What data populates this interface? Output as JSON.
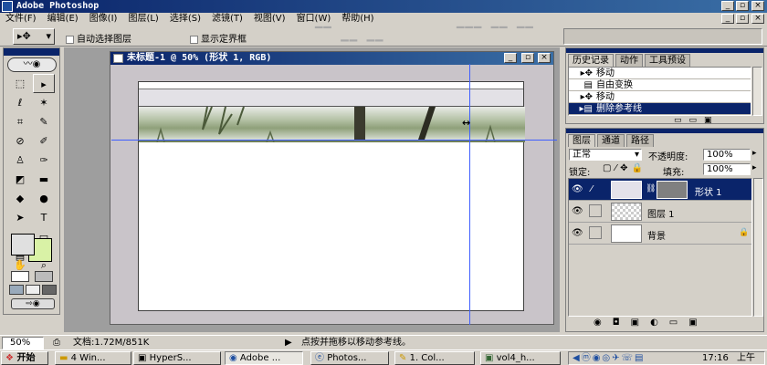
{
  "app": {
    "title": "Adobe Photoshop"
  },
  "menu": [
    "文件(F)",
    "编辑(E)",
    "图像(I)",
    "图层(L)",
    "选择(S)",
    "滤镜(T)",
    "视图(V)",
    "窗口(W)",
    "帮助(H)"
  ],
  "options": {
    "auto_select": "自动选择图层",
    "show_bounds": "显示定界框",
    "ghost_align": "▔▔ ▁▁ ▁▁",
    "ghost_distribute": "▔▔▔ ▔▔ ▔▔"
  },
  "document": {
    "title": "未标题-1 @ 50% (形状 1, RGB)"
  },
  "history": {
    "tabs": [
      "历史记录",
      "动作",
      "工具预设"
    ],
    "items": [
      "移动",
      "自由变换",
      "移动",
      "删除参考线"
    ],
    "selected_index": 3
  },
  "layers": {
    "tabs": [
      "图层",
      "通道",
      "路径"
    ],
    "blend_mode": "正常",
    "opacity_label": "不透明度:",
    "opacity": "100%",
    "lock_label": "锁定:",
    "fill_label": "填充:",
    "fill": "100%",
    "items": [
      {
        "name": "形状 1",
        "selected": true
      },
      {
        "name": "图层 1",
        "selected": false
      },
      {
        "name": "背景",
        "selected": false
      }
    ]
  },
  "status": {
    "zoom": "50%",
    "doc_info": "文档:1.72M/851K",
    "hint": "点按并拖移以移动参考线。"
  },
  "taskbar": {
    "start": "开始",
    "tasks": [
      "4 Win...",
      "HyperS...",
      "Adobe ...",
      "Photos...",
      "1. Col...",
      "vol4_h..."
    ],
    "clock": "17:16",
    "ampm": "上午"
  },
  "colors": {
    "titlebar": "#0a246a",
    "selection": "#0a246a",
    "guide": "#3f5fff",
    "foreground_swatch": "#e0e0e0",
    "background_swatch": "#d9f2a6"
  }
}
